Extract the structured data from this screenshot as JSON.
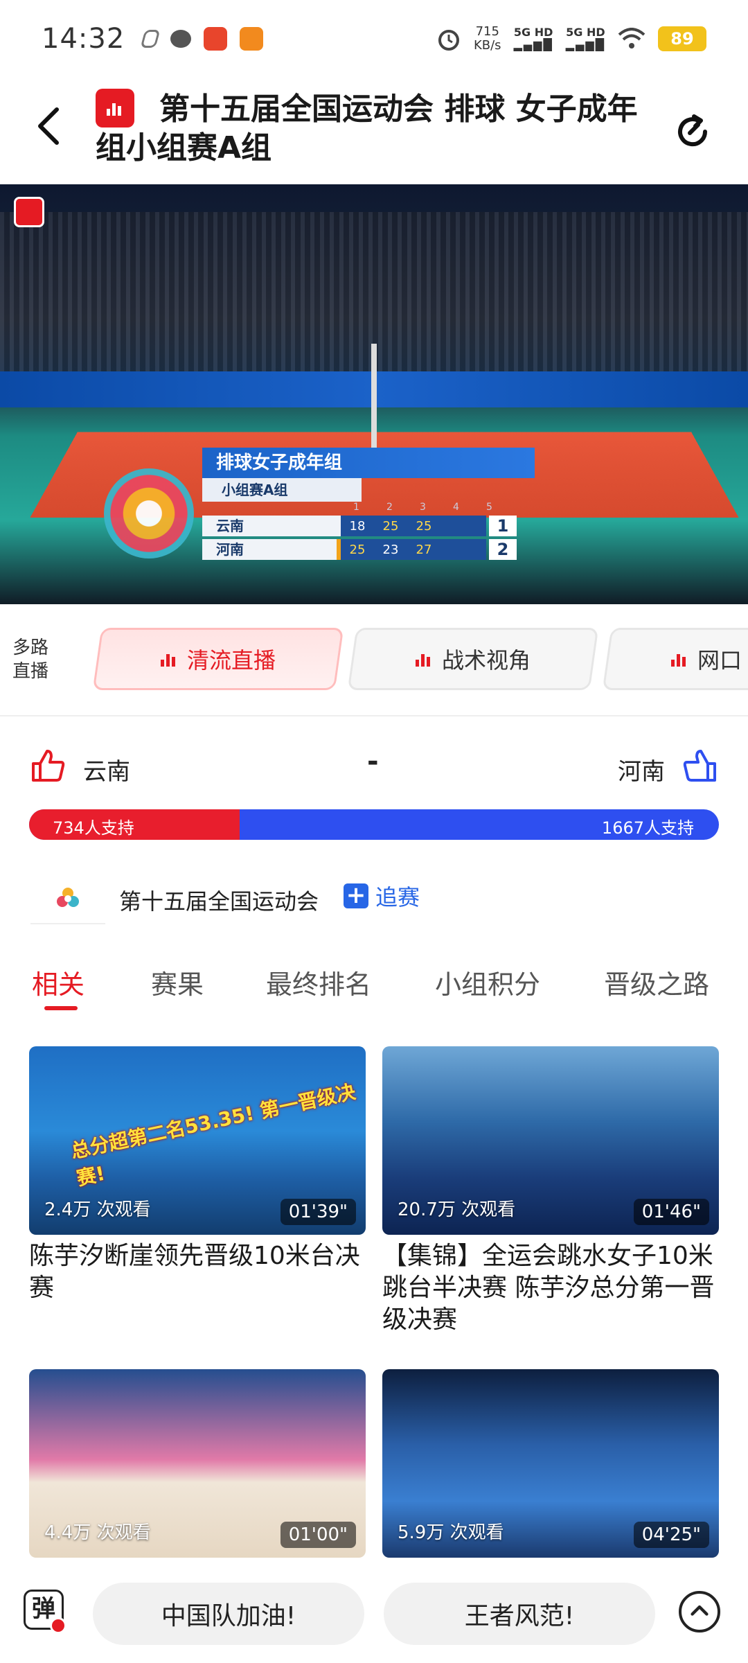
{
  "status_bar": {
    "time": "14:32",
    "net_speed": "715",
    "net_unit": "KB/s",
    "net1": "5G HD",
    "net2": "5G HD",
    "battery": "89"
  },
  "header": {
    "title": "第十五届全国运动会 排球 女子成年组小组赛A组"
  },
  "scoreboard": {
    "heading": "排球女子成年组",
    "subheading": "小组赛A组",
    "set_numbers": [
      "1",
      "2",
      "3",
      "4",
      "5"
    ],
    "teams": [
      {
        "name": "云南",
        "scores": [
          "18",
          "25",
          "25"
        ],
        "total": "1"
      },
      {
        "name": "河南",
        "scores": [
          "25",
          "23",
          "27"
        ],
        "total": "2"
      }
    ]
  },
  "multi_stream": {
    "label": "多路直播",
    "options": [
      "清流直播",
      "战术视角",
      "网口"
    ]
  },
  "support": {
    "left_team": "云南",
    "right_team": "河南",
    "separator": "-",
    "left_text": "734人支持",
    "right_text": "1667人支持",
    "left_fraction": 0.305
  },
  "event": {
    "name": "第十五届全国运动会",
    "follow_label": "追赛"
  },
  "tabs": [
    "相关",
    "赛果",
    "最终排名",
    "小组积分",
    "晋级之路"
  ],
  "videos": [
    {
      "views": "2.4万 次观看",
      "duration": "01'39\"",
      "title": "陈芋汐断崖领先晋级10米台决赛",
      "overlay": "总分超第二名53.35! 第一晋级决赛!"
    },
    {
      "views": "20.7万 次观看",
      "duration": "01'46\"",
      "title": "【集锦】全运会跳水女子10米跳台半决赛 陈芋汐总分第一晋级决赛",
      "overlay": ""
    },
    {
      "views": "4.4万 次观看",
      "duration": "01'00\"",
      "title": "",
      "overlay": ""
    },
    {
      "views": "5.9万 次观看",
      "duration": "04'25\"",
      "title": "",
      "overlay": ""
    }
  ],
  "bottom_bar": {
    "danmu_icon": "弹",
    "cheers": [
      "中国队加油!",
      "王者风范!"
    ]
  },
  "colors": {
    "accent": "#e51b23",
    "blue": "#2e4ff0",
    "follow_blue": "#2766e6"
  }
}
